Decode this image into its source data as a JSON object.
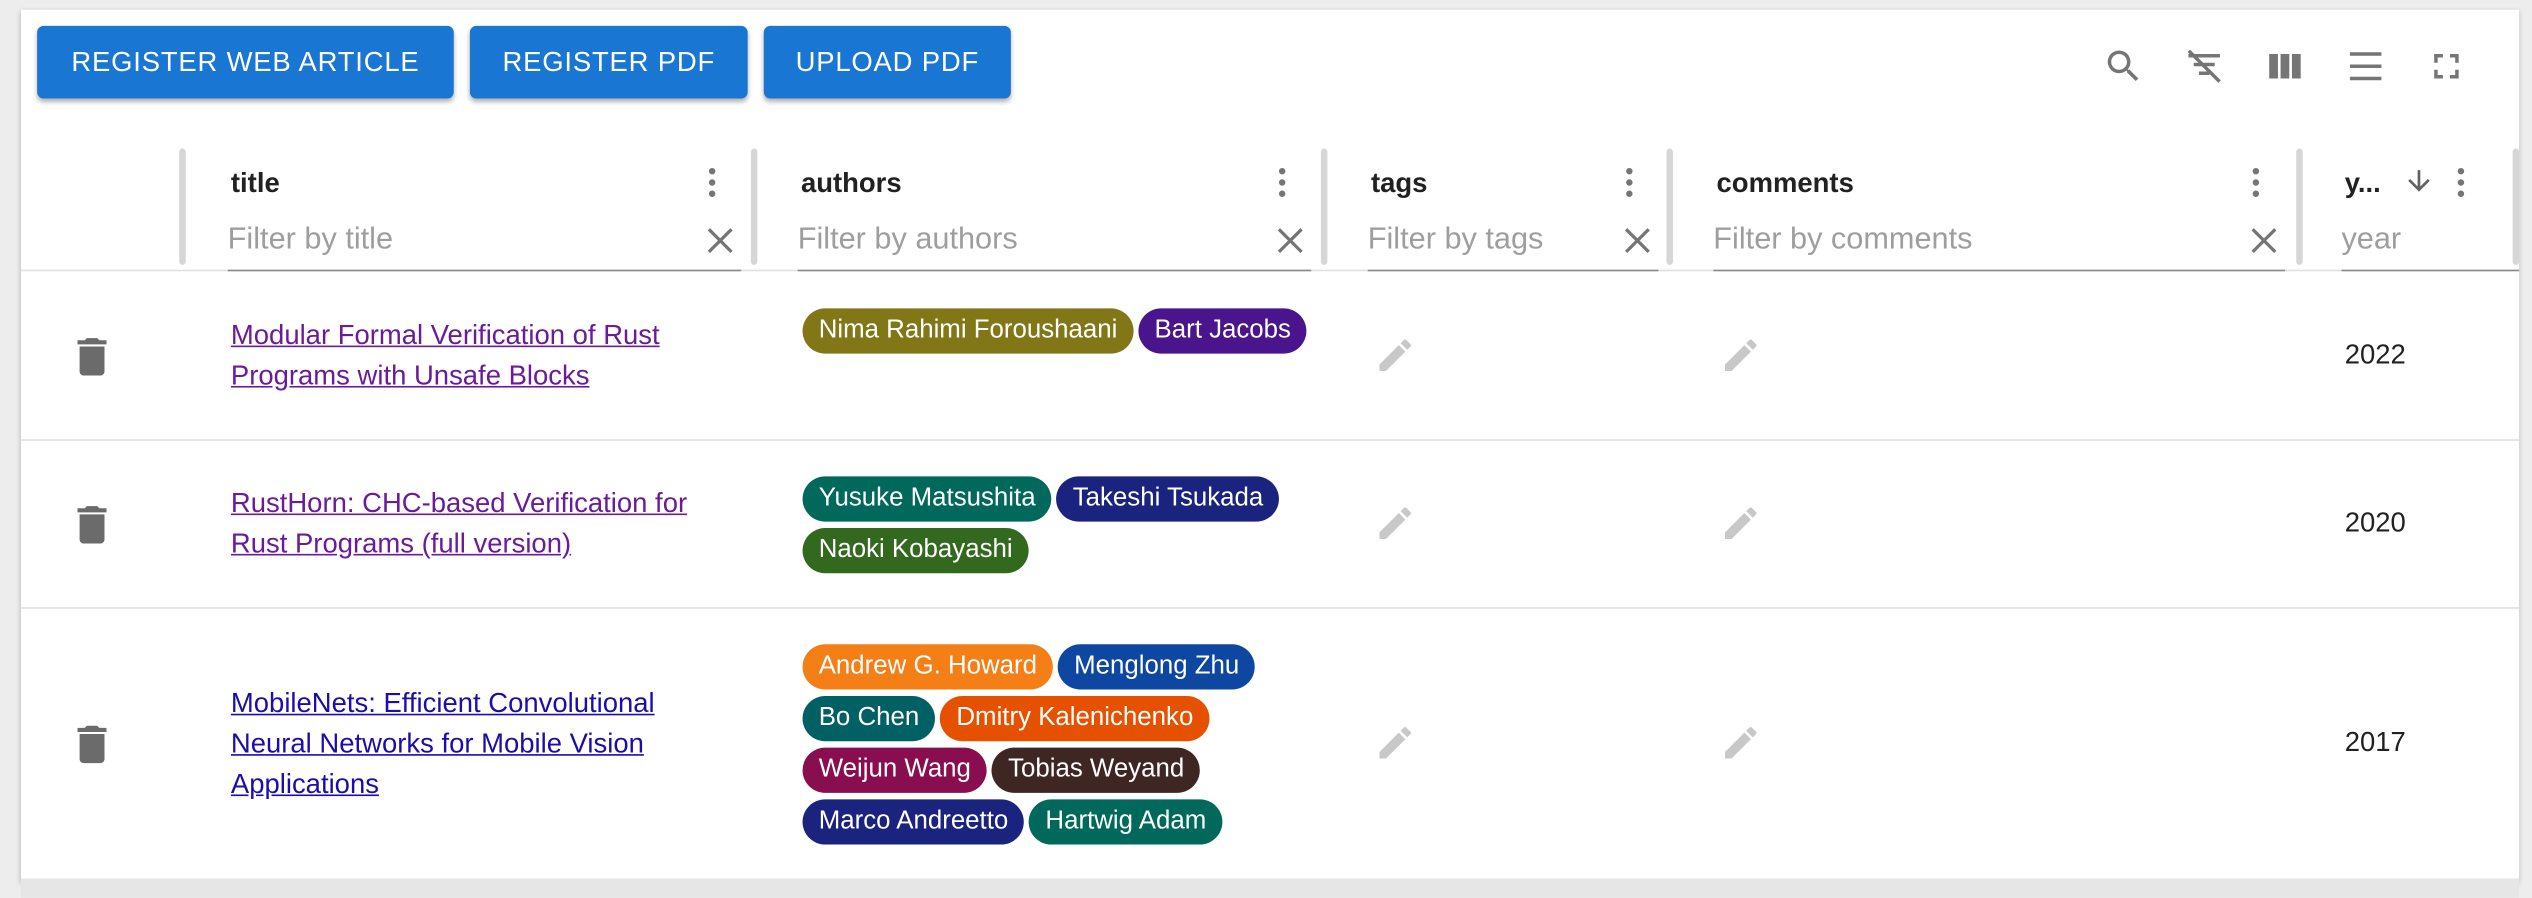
{
  "toolbar": {
    "register_web_article": "REGISTER WEB ARTICLE",
    "register_pdf": "REGISTER PDF",
    "upload_pdf": "UPLOAD PDF",
    "icons": [
      "search-icon",
      "filter-off-icon",
      "columns-icon",
      "density-icon",
      "fullscreen-icon"
    ]
  },
  "columns": {
    "title": {
      "label": "title",
      "placeholder": "Filter by title"
    },
    "authors": {
      "label": "authors",
      "placeholder": "Filter by authors"
    },
    "tags": {
      "label": "tags",
      "placeholder": "Filter by tags"
    },
    "comments": {
      "label": "comments",
      "placeholder": "Filter by comments"
    },
    "year": {
      "label": "y...",
      "placeholder": "year",
      "sort": "descending"
    }
  },
  "rows": [
    {
      "title": "Modular Formal Verification of Rust Programs with Unsafe Blocks",
      "visited": true,
      "authors": [
        {
          "name": "Nima Rahimi Foroushaani",
          "color": "#827717"
        },
        {
          "name": "Bart Jacobs",
          "color": "#4a148c"
        }
      ],
      "year": "2022"
    },
    {
      "title": "RustHorn: CHC-based Verification for Rust Programs (full version)",
      "visited": true,
      "authors": [
        {
          "name": "Yusuke Matsushita",
          "color": "#00695c"
        },
        {
          "name": "Takeshi Tsukada",
          "color": "#1a237e"
        },
        {
          "name": "Naoki Kobayashi",
          "color": "#33691e"
        }
      ],
      "year": "2020"
    },
    {
      "title": "MobileNets: Efficient Convolutional Neural Networks for Mobile Vision Applications",
      "visited": false,
      "authors": [
        {
          "name": "Andrew G. Howard",
          "color": "#f57f17"
        },
        {
          "name": "Menglong Zhu",
          "color": "#0d47a1"
        },
        {
          "name": "Bo Chen",
          "color": "#006064"
        },
        {
          "name": "Dmitry Kalenichenko",
          "color": "#e65100"
        },
        {
          "name": "Weijun Wang",
          "color": "#880e4f"
        },
        {
          "name": "Tobias Weyand",
          "color": "#3e2723"
        },
        {
          "name": "Marco Andreetto",
          "color": "#1a237e"
        },
        {
          "name": "Hartwig Adam",
          "color": "#00695c"
        }
      ],
      "year": "2017"
    }
  ]
}
